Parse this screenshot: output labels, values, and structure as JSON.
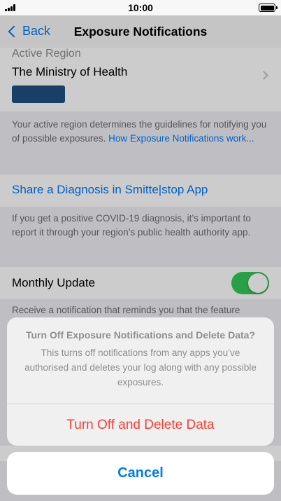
{
  "status_bar": {
    "time": "10:00"
  },
  "nav": {
    "back_label": "Back",
    "title": "Exposure Notifications"
  },
  "region": {
    "section_label": "Active Region",
    "name": "The Ministry of Health",
    "logo_color": "#1f4f80",
    "footer_text": "Your active region determines the guidelines for notifying you of possible exposures. ",
    "footer_link": "How Exposure Notifications work..."
  },
  "diagnosis": {
    "label": "Share a Diagnosis in Smitte|stop App",
    "footer_text": "If you get a positive COVID-19 diagnosis, it’s important to report it through your region’s public health authority app."
  },
  "monthly_update": {
    "label": "Monthly Update",
    "toggle_on": true,
    "footer_text": "Receive a notification that reminds you that the feature"
  },
  "action_sheet": {
    "title": "Turn Off Exposure Notifications and Delete Data?",
    "message": "This turns off notifications from any apps you’ve authorised and deletes your log along with any possible exposures.",
    "destructive_label": "Turn Off and Delete Data",
    "cancel_label": "Cancel"
  },
  "colors": {
    "accent": "#007aff",
    "destructive": "#ff3b30",
    "toggle_on": "#34c759"
  }
}
